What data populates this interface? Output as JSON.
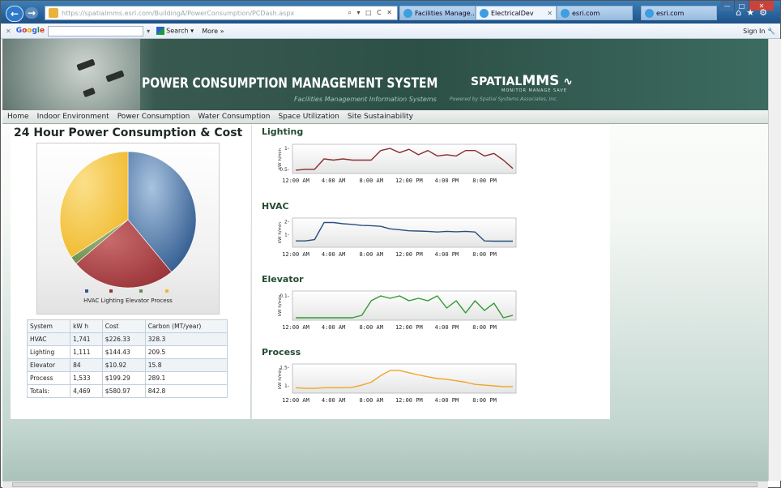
{
  "browser": {
    "address": "https://spatialmms.esri.com/BuildingA/PowerConsumption/PCDash.aspx",
    "address_host": "https://spatialmms.esri.com/",
    "tabs": [
      {
        "label": "Facilities Manage..."
      },
      {
        "label": "ElectricalDev"
      },
      {
        "label": "esri.com"
      },
      {
        "label": "esri.com"
      }
    ]
  },
  "google_toolbar": {
    "logo": "Google",
    "search_label": "Search",
    "more_label": "More",
    "sign_in": "Sign In"
  },
  "banner": {
    "title": "POWER CONSUMPTION MANAGEMENT SYSTEM",
    "subtitle": "Facilities Management Information Systems",
    "powered_by": "Powered by Spatial Systems Associates, Inc.",
    "logo_text": "SPATIAL",
    "logo_mms": "MMS",
    "logo_tag": "MONITOR MANAGE SAVE"
  },
  "nav": {
    "items": [
      "Home",
      "Indoor Environment",
      "Power Consumption",
      "Water Consumption",
      "Space Utilization",
      "Site Sustainability"
    ]
  },
  "dashboard": {
    "title": "24 Hour Power Consumption & Cost",
    "legend_text": "HVAC Lighting Elevator Process"
  },
  "colors": {
    "hvac": "#2f5a8e",
    "lighting": "#9a3438",
    "elevator": "#6a8e4a",
    "process": "#f0b82a",
    "lighting_line": "#8b2d31",
    "hvac_line": "#2a4f7e",
    "elevator_line": "#2f9a2f",
    "process_line": "#f0a52a"
  },
  "table": {
    "headers": [
      "System",
      "kW h",
      "Cost",
      "Carbon (MT/year)"
    ],
    "rows": [
      [
        "HVAC",
        "1,741",
        "$226.33",
        "328.3"
      ],
      [
        "Lighting",
        "1,111",
        "$144.43",
        "209.5"
      ],
      [
        "Elevator",
        "84",
        "$10.92",
        "15.8"
      ],
      [
        "Process",
        "1,533",
        "$199.29",
        "289.1"
      ]
    ],
    "totals": [
      "Totals:",
      "4,469",
      "$580.97",
      "842.8"
    ]
  },
  "chart_data": [
    {
      "type": "pie",
      "title": "24 Hour Power Consumption & Cost",
      "categories": [
        "HVAC",
        "Lighting",
        "Elevator",
        "Process"
      ],
      "values": [
        1741,
        1111,
        84,
        1533
      ],
      "legend": "bottom"
    },
    {
      "type": "line",
      "title": "Lighting",
      "ylabel": "kW h/min",
      "yticks": [
        "0.5",
        "1"
      ],
      "ylim": [
        0.4,
        1.1
      ],
      "xticks": [
        "12:00 AM",
        "4:00 AM",
        "8:00 AM",
        "12:00 PM",
        "4:00 PM",
        "8:00 PM"
      ],
      "x_hours": [
        0,
        1,
        2,
        3,
        4,
        5,
        6,
        7,
        8,
        9,
        10,
        11,
        12,
        13,
        14,
        15,
        16,
        17,
        18,
        19,
        20,
        21,
        22,
        23
      ],
      "values": [
        0.48,
        0.5,
        0.5,
        0.75,
        0.72,
        0.75,
        0.72,
        0.72,
        0.72,
        0.95,
        1.0,
        0.9,
        0.98,
        0.85,
        0.95,
        0.82,
        0.85,
        0.82,
        0.95,
        0.95,
        0.82,
        0.88,
        0.72,
        0.52
      ],
      "grid": false
    },
    {
      "type": "line",
      "title": "HVAC",
      "ylabel": "kW h/min",
      "yticks": [
        "1",
        "2"
      ],
      "ylim": [
        0,
        2.3
      ],
      "xticks": [
        "12:00 AM",
        "4:00 AM",
        "8:00 AM",
        "12:00 PM",
        "4:00 PM",
        "8:00 PM"
      ],
      "x_hours": [
        0,
        1,
        2,
        3,
        4,
        5,
        6,
        7,
        8,
        9,
        10,
        11,
        12,
        13,
        14,
        15,
        16,
        17,
        18,
        19,
        20,
        21,
        22,
        23
      ],
      "values": [
        0.5,
        0.5,
        0.6,
        1.95,
        1.95,
        1.85,
        1.8,
        1.72,
        1.7,
        1.65,
        1.45,
        1.38,
        1.3,
        1.28,
        1.25,
        1.2,
        1.25,
        1.22,
        1.25,
        1.2,
        0.5,
        0.48,
        0.48,
        0.48
      ],
      "grid": false
    },
    {
      "type": "line",
      "title": "Elevator",
      "ylabel": "kW h/min",
      "yticks": [
        "0.1"
      ],
      "ylim": [
        0,
        0.12
      ],
      "xticks": [
        "12:00 AM",
        "4:00 AM",
        "8:00 AM",
        "12:00 PM",
        "4:00 PM",
        "8:00 PM"
      ],
      "x_hours": [
        0,
        1,
        2,
        3,
        4,
        5,
        6,
        7,
        8,
        9,
        10,
        11,
        12,
        13,
        14,
        15,
        16,
        17,
        18,
        19,
        20,
        21,
        22,
        23
      ],
      "values": [
        0.01,
        0.01,
        0.01,
        0.01,
        0.01,
        0.01,
        0.01,
        0.02,
        0.08,
        0.1,
        0.09,
        0.1,
        0.08,
        0.09,
        0.08,
        0.1,
        0.05,
        0.08,
        0.03,
        0.08,
        0.04,
        0.07,
        0.01,
        0.02
      ],
      "grid": false
    },
    {
      "type": "line",
      "title": "Process",
      "ylabel": "kW h/min",
      "yticks": [
        "1",
        "1.5"
      ],
      "ylim": [
        0.8,
        1.6
      ],
      "xticks": [
        "12:00 AM",
        "4:00 AM",
        "8:00 AM",
        "12:00 PM",
        "4:00 PM",
        "8:00 PM"
      ],
      "x_hours": [
        0,
        1,
        2,
        3,
        4,
        5,
        6,
        7,
        8,
        9,
        10,
        11,
        12,
        13,
        14,
        15,
        16,
        17,
        18,
        19,
        20,
        21,
        22,
        23
      ],
      "values": [
        0.95,
        0.93,
        0.93,
        0.95,
        0.95,
        0.95,
        0.96,
        1.02,
        1.1,
        1.28,
        1.42,
        1.42,
        1.36,
        1.3,
        1.25,
        1.2,
        1.18,
        1.14,
        1.1,
        1.04,
        1.02,
        1.0,
        0.98,
        0.98
      ],
      "grid": false
    }
  ]
}
